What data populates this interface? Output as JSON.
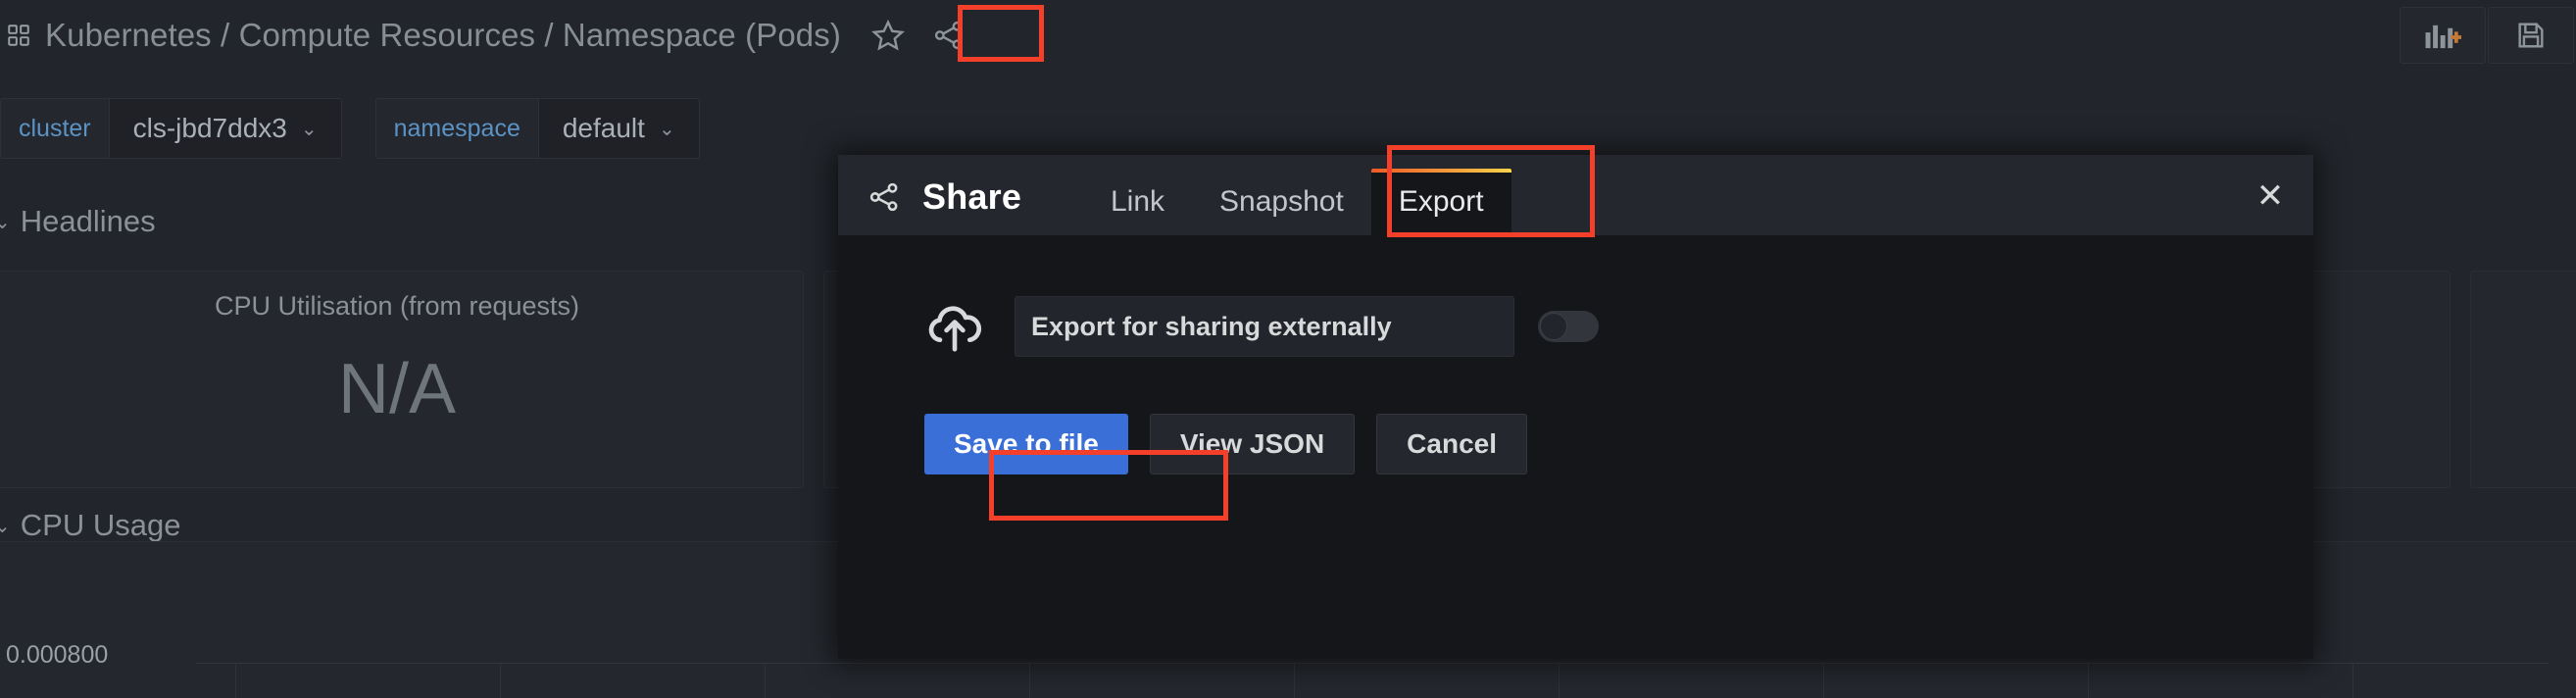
{
  "app": {
    "breadcrumb": "Kubernetes / Compute Resources / Namespace (Pods)",
    "dashboard_icon": "dashboard-grid-icon",
    "favorite_icon": "star-icon",
    "share_icon": "share-nodes-icon"
  },
  "toolbar": {
    "add_panel_icon": "add-panel-icon",
    "save_dashboard_icon": "save-disk-icon"
  },
  "variables": [
    {
      "label": "cluster",
      "value": "cls-jbd7ddx3",
      "caret": "⌄"
    },
    {
      "label": "namespace",
      "value": "default",
      "caret": "⌄"
    }
  ],
  "rows": [
    {
      "chevron": "⌄",
      "title": "Headlines"
    },
    {
      "chevron": "⌄",
      "title": "CPU Usage"
    }
  ],
  "stat_panel": {
    "title": "CPU Utilisation (from requests)",
    "value": "N/A"
  },
  "graph": {
    "y_tick": "0.000800"
  },
  "modal": {
    "icon": "share-nodes-icon",
    "title": "Share",
    "close_label": "✕",
    "tabs": [
      {
        "label": "Link",
        "active": false
      },
      {
        "label": "Snapshot",
        "active": false
      },
      {
        "label": "Export",
        "active": true
      }
    ],
    "export": {
      "icon": "cloud-upload-icon",
      "field_label": "Export for sharing externally",
      "toggle_state": "off",
      "buttons": [
        {
          "label": "Save to file",
          "style": "primary",
          "highlighted": true
        },
        {
          "label": "View JSON",
          "style": "secondary",
          "highlighted": false
        },
        {
          "label": "Cancel",
          "style": "secondary",
          "highlighted": false
        }
      ]
    }
  },
  "annotations": {
    "color": "#f4402a",
    "targets": [
      "share-icon",
      "export-tab",
      "save-to-file-button"
    ]
  }
}
